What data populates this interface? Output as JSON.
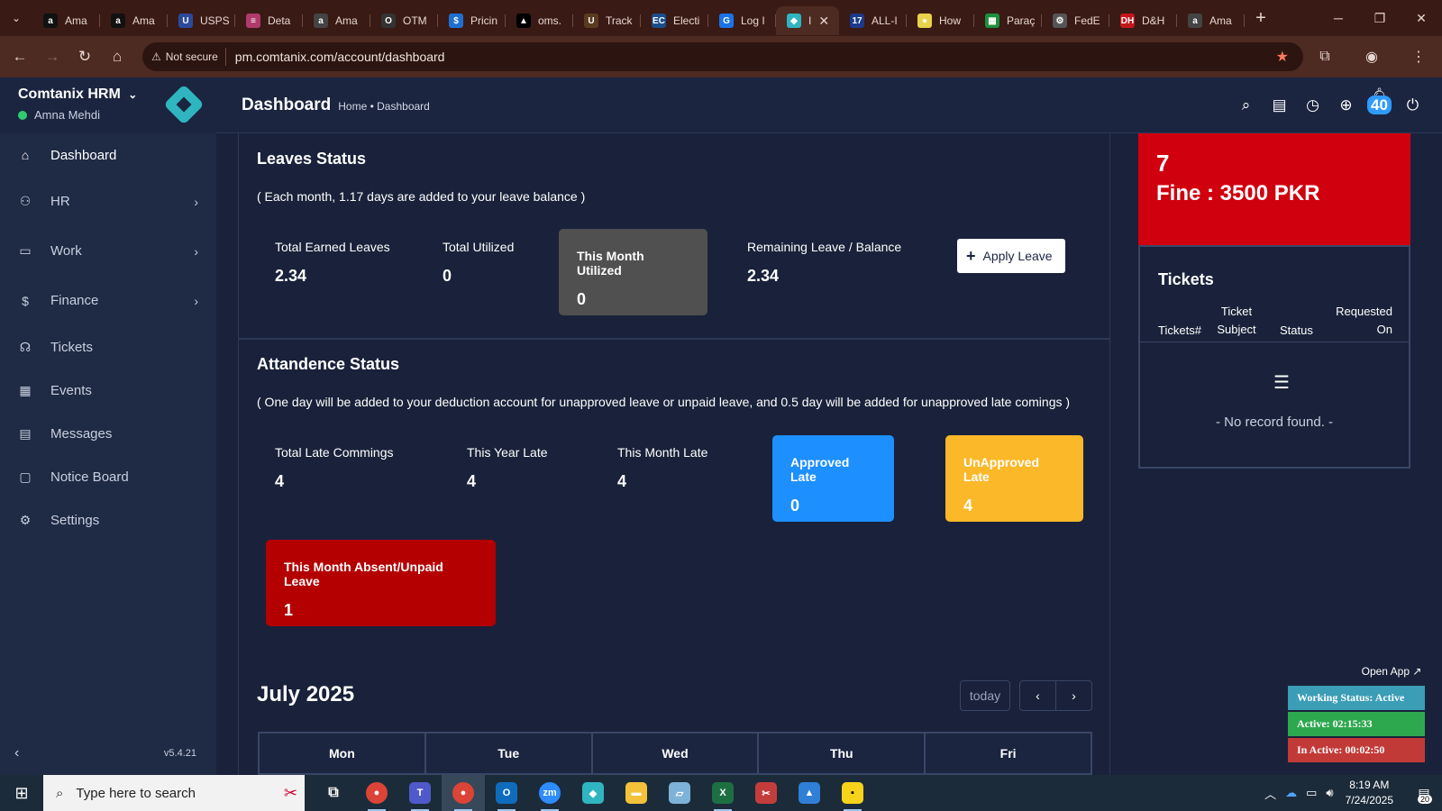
{
  "browser": {
    "tabs": [
      {
        "label": "Ama",
        "favicon": "a",
        "color": "#111111"
      },
      {
        "label": "Ama",
        "favicon": "a",
        "color": "#111111"
      },
      {
        "label": "USPS",
        "favicon": "U",
        "color": "#2b4a9c"
      },
      {
        "label": "Deta",
        "favicon": "≡",
        "color": "#b03a6b"
      },
      {
        "label": "Ama",
        "favicon": "a",
        "color": "#444444"
      },
      {
        "label": "OTM",
        "favicon": "O",
        "color": "#333333"
      },
      {
        "label": "Pricin",
        "favicon": "$",
        "color": "#1f6fd1"
      },
      {
        "label": "oms.",
        "favicon": "▲",
        "color": "#000000"
      },
      {
        "label": "Track",
        "favicon": "U",
        "color": "#5a3b22"
      },
      {
        "label": "Electi",
        "favicon": "EC",
        "color": "#1b4d8c"
      },
      {
        "label": "Log I",
        "favicon": "G",
        "color": "#1a73e8"
      },
      {
        "label": "I",
        "favicon": "◆",
        "color": "#2fb5c0",
        "active": true
      },
      {
        "label": "ALL-I",
        "favicon": "17",
        "color": "#1b3a8c"
      },
      {
        "label": "How",
        "favicon": "●",
        "color": "#e8d24a"
      },
      {
        "label": "Paraç",
        "favicon": "▦",
        "color": "#1e8e3e"
      },
      {
        "label": "FedE",
        "favicon": "⚙",
        "color": "#555555"
      },
      {
        "label": "D&H",
        "favicon": "DH",
        "color": "#c4161c"
      },
      {
        "label": "Ama",
        "favicon": "a",
        "color": "#444444"
      }
    ],
    "not_secure_label": "Not secure",
    "url": "pm.comtanix.com/account/dashboard"
  },
  "sidebar": {
    "brand": "Comtanix HRM",
    "user": "Amna Mehdi",
    "items": [
      {
        "label": "Dashboard",
        "icon": "home-icon",
        "glyph": "⌂",
        "has_submenu": false,
        "active": true
      },
      {
        "label": "HR",
        "icon": "users-icon",
        "glyph": "⚇",
        "has_submenu": true
      },
      {
        "label": "Work",
        "icon": "briefcase-icon",
        "glyph": "▭",
        "has_submenu": true
      },
      {
        "label": "Finance",
        "icon": "dollar-icon",
        "glyph": "$",
        "has_submenu": true
      },
      {
        "label": "Tickets",
        "icon": "headset-icon",
        "glyph": "☊",
        "has_submenu": false
      },
      {
        "label": "Events",
        "icon": "calendar-icon",
        "glyph": "▦",
        "has_submenu": false
      },
      {
        "label": "Messages",
        "icon": "message-icon",
        "glyph": "▤",
        "has_submenu": false
      },
      {
        "label": "Notice Board",
        "icon": "clipboard-icon",
        "glyph": "▢",
        "has_submenu": false
      },
      {
        "label": "Settings",
        "icon": "gear-icon",
        "glyph": "⚙",
        "has_submenu": false
      }
    ],
    "version": "v5.4.21"
  },
  "header": {
    "title": "Dashboard",
    "breadcrumb": "Home • Dashboard",
    "notification_count": "40"
  },
  "leaves": {
    "title": "Leaves Status",
    "note": "( Each month, 1.17 days are added to your leave balance )",
    "total_earned_label": "Total Earned Leaves",
    "total_earned_value": "2.34",
    "total_utilized_label": "Total Utilized",
    "total_utilized_value": "0",
    "month_utilized_label": "This Month Utilized",
    "month_utilized_value": "0",
    "remaining_label": "Remaining Leave / Balance",
    "remaining_value": "2.34",
    "apply_button": "Apply Leave"
  },
  "attendance": {
    "title": "Attandence Status",
    "note": "( One day will be added to your deduction account for unapproved leave or unpaid leave, and 0.5 day will be added for unapproved late comings )",
    "total_late_label": "Total Late Commings",
    "total_late_value": "4",
    "year_late_label": "This Year Late",
    "year_late_value": "4",
    "month_late_label": "This Month Late",
    "month_late_value": "4",
    "approved_late_label": "Approved Late",
    "approved_late_value": "0",
    "unapproved_late_label": "UnApproved Late",
    "unapproved_late_value": "4",
    "absent_label": "This Month Absent/Unpaid Leave",
    "absent_value": "1"
  },
  "calendar": {
    "month": "July 2025",
    "today_label": "today",
    "days": [
      "Mon",
      "Tue",
      "Wed",
      "Thu",
      "Fri"
    ]
  },
  "fine": {
    "count": "7",
    "amount": "Fine : 3500 PKR"
  },
  "tickets": {
    "title": "Tickets",
    "columns": [
      "Tickets#",
      "Ticket Subject",
      "Status",
      "Requested On"
    ],
    "empty_text": "- No record found. -"
  },
  "widget": {
    "open_app": "Open App ↗",
    "status": "Working Status: Active",
    "active_time": "Active: 02:15:33",
    "inactive_time": "In Active: 00:02:50"
  },
  "taskbar": {
    "search_placeholder": "Type here to search",
    "time": "8:19 AM",
    "date": "7/24/2025",
    "notification_count": "20"
  },
  "colors": {
    "month_utilized_bg": "#505050",
    "approved_late_bg": "#1e8fff",
    "unapproved_late_bg": "#fbb829",
    "absent_bg": "#b40000",
    "fine_bg": "#d1000f"
  }
}
